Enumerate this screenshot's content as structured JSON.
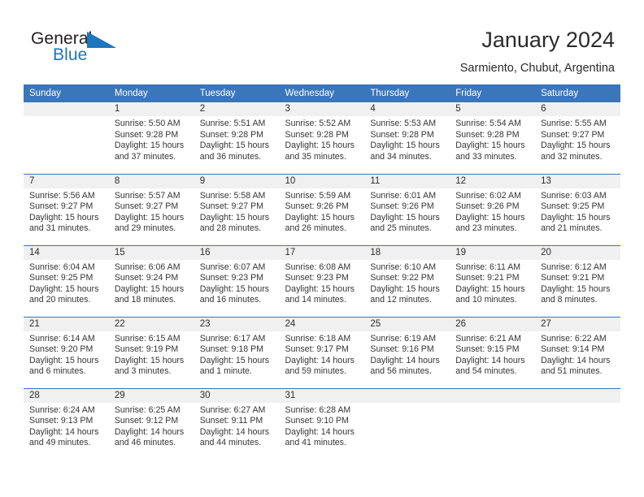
{
  "brand": {
    "name_top": "General",
    "name_bottom": "Blue",
    "triangle_icon": "triangle-icon",
    "color_dark": "#231f20",
    "color_blue": "#1d75bd"
  },
  "header": {
    "title": "January 2024",
    "subtitle": "Sarmiento, Chubut, Argentina"
  },
  "theme": {
    "header_blue": "#3a76ba",
    "row_divider_blue": "#3a76ba",
    "daynum_band": "#f0f0f0",
    "text": "#353535"
  },
  "calendar": {
    "weekday_headers": [
      "Sunday",
      "Monday",
      "Tuesday",
      "Wednesday",
      "Thursday",
      "Friday",
      "Saturday"
    ],
    "weeks": [
      [
        {
          "day": "",
          "sunrise": "",
          "sunset": "",
          "daylight_line1": "",
          "daylight_line2": ""
        },
        {
          "day": "1",
          "sunrise": "Sunrise: 5:50 AM",
          "sunset": "Sunset: 9:28 PM",
          "daylight_line1": "Daylight: 15 hours",
          "daylight_line2": "and 37 minutes."
        },
        {
          "day": "2",
          "sunrise": "Sunrise: 5:51 AM",
          "sunset": "Sunset: 9:28 PM",
          "daylight_line1": "Daylight: 15 hours",
          "daylight_line2": "and 36 minutes."
        },
        {
          "day": "3",
          "sunrise": "Sunrise: 5:52 AM",
          "sunset": "Sunset: 9:28 PM",
          "daylight_line1": "Daylight: 15 hours",
          "daylight_line2": "and 35 minutes."
        },
        {
          "day": "4",
          "sunrise": "Sunrise: 5:53 AM",
          "sunset": "Sunset: 9:28 PM",
          "daylight_line1": "Daylight: 15 hours",
          "daylight_line2": "and 34 minutes."
        },
        {
          "day": "5",
          "sunrise": "Sunrise: 5:54 AM",
          "sunset": "Sunset: 9:28 PM",
          "daylight_line1": "Daylight: 15 hours",
          "daylight_line2": "and 33 minutes."
        },
        {
          "day": "6",
          "sunrise": "Sunrise: 5:55 AM",
          "sunset": "Sunset: 9:27 PM",
          "daylight_line1": "Daylight: 15 hours",
          "daylight_line2": "and 32 minutes."
        }
      ],
      [
        {
          "day": "7",
          "sunrise": "Sunrise: 5:56 AM",
          "sunset": "Sunset: 9:27 PM",
          "daylight_line1": "Daylight: 15 hours",
          "daylight_line2": "and 31 minutes."
        },
        {
          "day": "8",
          "sunrise": "Sunrise: 5:57 AM",
          "sunset": "Sunset: 9:27 PM",
          "daylight_line1": "Daylight: 15 hours",
          "daylight_line2": "and 29 minutes."
        },
        {
          "day": "9",
          "sunrise": "Sunrise: 5:58 AM",
          "sunset": "Sunset: 9:27 PM",
          "daylight_line1": "Daylight: 15 hours",
          "daylight_line2": "and 28 minutes."
        },
        {
          "day": "10",
          "sunrise": "Sunrise: 5:59 AM",
          "sunset": "Sunset: 9:26 PM",
          "daylight_line1": "Daylight: 15 hours",
          "daylight_line2": "and 26 minutes."
        },
        {
          "day": "11",
          "sunrise": "Sunrise: 6:01 AM",
          "sunset": "Sunset: 9:26 PM",
          "daylight_line1": "Daylight: 15 hours",
          "daylight_line2": "and 25 minutes."
        },
        {
          "day": "12",
          "sunrise": "Sunrise: 6:02 AM",
          "sunset": "Sunset: 9:26 PM",
          "daylight_line1": "Daylight: 15 hours",
          "daylight_line2": "and 23 minutes."
        },
        {
          "day": "13",
          "sunrise": "Sunrise: 6:03 AM",
          "sunset": "Sunset: 9:25 PM",
          "daylight_line1": "Daylight: 15 hours",
          "daylight_line2": "and 21 minutes."
        }
      ],
      [
        {
          "day": "14",
          "sunrise": "Sunrise: 6:04 AM",
          "sunset": "Sunset: 9:25 PM",
          "daylight_line1": "Daylight: 15 hours",
          "daylight_line2": "and 20 minutes."
        },
        {
          "day": "15",
          "sunrise": "Sunrise: 6:06 AM",
          "sunset": "Sunset: 9:24 PM",
          "daylight_line1": "Daylight: 15 hours",
          "daylight_line2": "and 18 minutes."
        },
        {
          "day": "16",
          "sunrise": "Sunrise: 6:07 AM",
          "sunset": "Sunset: 9:23 PM",
          "daylight_line1": "Daylight: 15 hours",
          "daylight_line2": "and 16 minutes."
        },
        {
          "day": "17",
          "sunrise": "Sunrise: 6:08 AM",
          "sunset": "Sunset: 9:23 PM",
          "daylight_line1": "Daylight: 15 hours",
          "daylight_line2": "and 14 minutes."
        },
        {
          "day": "18",
          "sunrise": "Sunrise: 6:10 AM",
          "sunset": "Sunset: 9:22 PM",
          "daylight_line1": "Daylight: 15 hours",
          "daylight_line2": "and 12 minutes."
        },
        {
          "day": "19",
          "sunrise": "Sunrise: 6:11 AM",
          "sunset": "Sunset: 9:21 PM",
          "daylight_line1": "Daylight: 15 hours",
          "daylight_line2": "and 10 minutes."
        },
        {
          "day": "20",
          "sunrise": "Sunrise: 6:12 AM",
          "sunset": "Sunset: 9:21 PM",
          "daylight_line1": "Daylight: 15 hours",
          "daylight_line2": "and 8 minutes."
        }
      ],
      [
        {
          "day": "21",
          "sunrise": "Sunrise: 6:14 AM",
          "sunset": "Sunset: 9:20 PM",
          "daylight_line1": "Daylight: 15 hours",
          "daylight_line2": "and 6 minutes."
        },
        {
          "day": "22",
          "sunrise": "Sunrise: 6:15 AM",
          "sunset": "Sunset: 9:19 PM",
          "daylight_line1": "Daylight: 15 hours",
          "daylight_line2": "and 3 minutes."
        },
        {
          "day": "23",
          "sunrise": "Sunrise: 6:17 AM",
          "sunset": "Sunset: 9:18 PM",
          "daylight_line1": "Daylight: 15 hours",
          "daylight_line2": "and 1 minute."
        },
        {
          "day": "24",
          "sunrise": "Sunrise: 6:18 AM",
          "sunset": "Sunset: 9:17 PM",
          "daylight_line1": "Daylight: 14 hours",
          "daylight_line2": "and 59 minutes."
        },
        {
          "day": "25",
          "sunrise": "Sunrise: 6:19 AM",
          "sunset": "Sunset: 9:16 PM",
          "daylight_line1": "Daylight: 14 hours",
          "daylight_line2": "and 56 minutes."
        },
        {
          "day": "26",
          "sunrise": "Sunrise: 6:21 AM",
          "sunset": "Sunset: 9:15 PM",
          "daylight_line1": "Daylight: 14 hours",
          "daylight_line2": "and 54 minutes."
        },
        {
          "day": "27",
          "sunrise": "Sunrise: 6:22 AM",
          "sunset": "Sunset: 9:14 PM",
          "daylight_line1": "Daylight: 14 hours",
          "daylight_line2": "and 51 minutes."
        }
      ],
      [
        {
          "day": "28",
          "sunrise": "Sunrise: 6:24 AM",
          "sunset": "Sunset: 9:13 PM",
          "daylight_line1": "Daylight: 14 hours",
          "daylight_line2": "and 49 minutes."
        },
        {
          "day": "29",
          "sunrise": "Sunrise: 6:25 AM",
          "sunset": "Sunset: 9:12 PM",
          "daylight_line1": "Daylight: 14 hours",
          "daylight_line2": "and 46 minutes."
        },
        {
          "day": "30",
          "sunrise": "Sunrise: 6:27 AM",
          "sunset": "Sunset: 9:11 PM",
          "daylight_line1": "Daylight: 14 hours",
          "daylight_line2": "and 44 minutes."
        },
        {
          "day": "31",
          "sunrise": "Sunrise: 6:28 AM",
          "sunset": "Sunset: 9:10 PM",
          "daylight_line1": "Daylight: 14 hours",
          "daylight_line2": "and 41 minutes."
        },
        {
          "day": "",
          "sunrise": "",
          "sunset": "",
          "daylight_line1": "",
          "daylight_line2": ""
        },
        {
          "day": "",
          "sunrise": "",
          "sunset": "",
          "daylight_line1": "",
          "daylight_line2": ""
        },
        {
          "day": "",
          "sunrise": "",
          "sunset": "",
          "daylight_line1": "",
          "daylight_line2": ""
        }
      ]
    ]
  }
}
